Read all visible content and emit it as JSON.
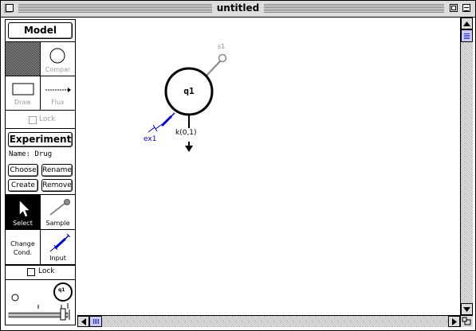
{
  "window": {
    "title": "untitled"
  },
  "palette": {
    "model_label": "Model",
    "compartment_label": "Compar",
    "draw_label": "Draw",
    "flux_label": "Flux",
    "model_lock_label": "Lock",
    "experiment_label": "Experiment",
    "name_text": "Name: Drug",
    "choose_label": "Choose",
    "rename_label": "Rename",
    "create_label": "Create",
    "remove_label": "Remove",
    "select_label": "Select",
    "sample_label": "Sample",
    "change_cond_line1": "Change",
    "change_cond_line2": "Cond.",
    "input_label": "Input",
    "lock_label": "Lock",
    "zoom_icon_label": "q1"
  },
  "diagram": {
    "compartment_label": "q1",
    "sample_label": "s1",
    "input_label": "ex1",
    "rate_label": "k(0,1)"
  },
  "colors": {
    "input_blue": "#0000cc",
    "select_bg": "#000000"
  },
  "icons": [
    "close-box-icon",
    "zoom-box-icon",
    "collapse-box-icon",
    "pattern-swatch-icon",
    "circle-compartment-icon",
    "rectangle-draw-icon",
    "flux-arrow-icon",
    "cursor-arrow-icon",
    "sample-probe-icon",
    "syringe-icon",
    "zoom-slider-icon",
    "scroll-up-icon",
    "scroll-down-icon",
    "scroll-left-icon",
    "scroll-right-icon",
    "grow-box-icon"
  ]
}
